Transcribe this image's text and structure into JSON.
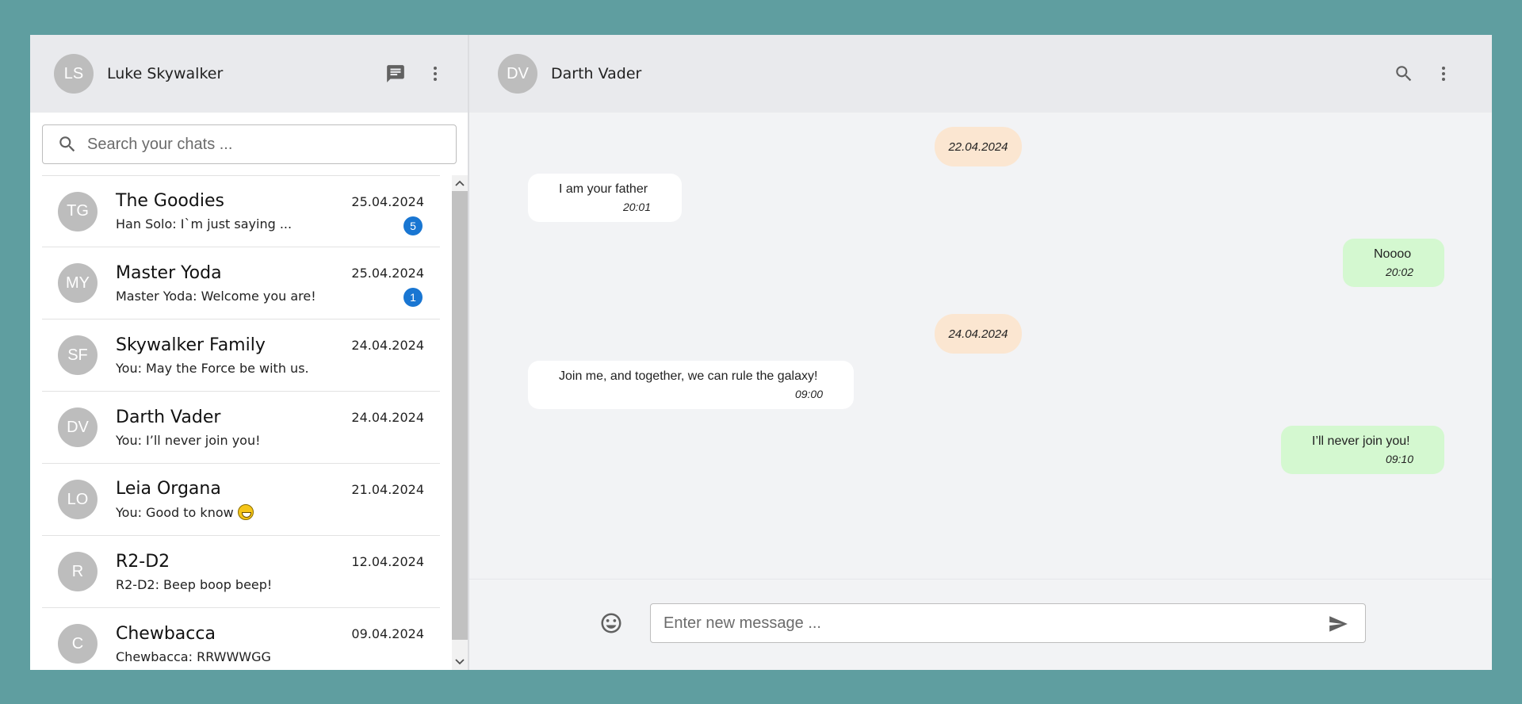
{
  "user": {
    "initials": "LS",
    "name": "Luke Skywalker"
  },
  "search": {
    "placeholder": "Search your chats ..."
  },
  "chats": [
    {
      "initials": "TG",
      "name": "The Goodies",
      "last": "Han Solo: I`m just saying ...",
      "date": "25.04.2024",
      "unread": "5"
    },
    {
      "initials": "MY",
      "name": "Master Yoda",
      "last": "Master Yoda: Welcome you are!",
      "date": "25.04.2024",
      "unread": "1"
    },
    {
      "initials": "SF",
      "name": "Skywalker Family",
      "last": "You: May the Force be with us.",
      "date": "24.04.2024"
    },
    {
      "initials": "DV",
      "name": "Darth Vader",
      "last": "You: I’ll never join you!",
      "date": "24.04.2024"
    },
    {
      "initials": "LO",
      "name": "Leia Organa",
      "last": "You: Good to know",
      "date": "21.04.2024",
      "emoji": "grinning-face-emoji"
    },
    {
      "initials": "R",
      "name": "R2-D2",
      "last": "R2-D2: Beep boop beep!",
      "date": "12.04.2024"
    },
    {
      "initials": "C",
      "name": "Chewbacca",
      "last": "Chewbacca: RRWWWGG",
      "date": "09.04.2024"
    }
  ],
  "conversation": {
    "initials": "DV",
    "name": "Darth Vader",
    "dates": [
      "22.04.2024",
      "24.04.2024"
    ],
    "messages": [
      {
        "text": "I am your father",
        "time": "20:01",
        "direction": "incoming"
      },
      {
        "text": "Noooo",
        "time": "20:02",
        "direction": "outgoing"
      },
      {
        "text": "Join me, and together, we can rule the galaxy!",
        "time": "09:00",
        "direction": "incoming"
      },
      {
        "text": "I’ll never join you!",
        "time": "09:10",
        "direction": "outgoing"
      }
    ]
  },
  "composer": {
    "placeholder": "Enter new message ..."
  },
  "icons": {
    "new_chat": "chat-icon",
    "menu": "more-vert-icon",
    "search": "search-icon",
    "emoji": "emoji-icon",
    "send": "send-icon"
  },
  "colors": {
    "background": "#5f9ea0",
    "header": "#e9eaed",
    "badge": "#1976d2",
    "outgoing_bubble": "#d4f8d0",
    "date_pill": "#fbe6d1"
  }
}
